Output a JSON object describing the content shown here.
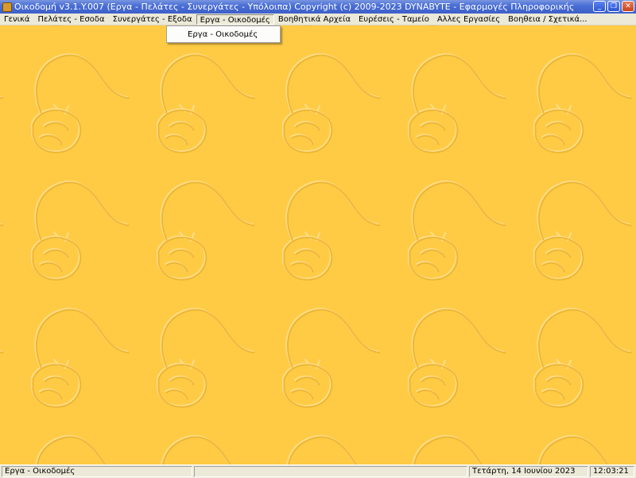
{
  "window": {
    "title": "Οικοδομή v3.1.Y.007  (Εργα - Πελάτες - Συνεργάτες - Υπόλοιπα)   Copyright (c) 2009-2023  DYNABYTE - Εφαρμογές Πληροφορικής",
    "minimize_glyph": "_",
    "maximize_glyph": "❐",
    "close_glyph": "✕"
  },
  "menu": {
    "items": [
      {
        "label": "Γενικά"
      },
      {
        "label": "Πελάτες - Εσοδα"
      },
      {
        "label": "Συνεργάτες - Εξοδα"
      },
      {
        "label": "Εργα - Οικοδομές",
        "active": true
      },
      {
        "label": "Βοηθητικά Αρχεία"
      },
      {
        "label": "Ευρέσεις - Ταμείο"
      },
      {
        "label": "Αλλες Εργασίες"
      },
      {
        "label": "Βοηθεια / Σχετικά..."
      }
    ],
    "dropdown": {
      "items": [
        {
          "label": "Εργα - Οικοδομές"
        }
      ]
    }
  },
  "workspace": {
    "background_color": "#ffcb45",
    "watermark_icon": "flower-watermark-icon"
  },
  "statusbar": {
    "message": "Εργα - Οικοδομές",
    "empty_panel": "",
    "date": "Τετάρτη, 14 Ιουνίου 2023",
    "time": "12:03:21"
  }
}
